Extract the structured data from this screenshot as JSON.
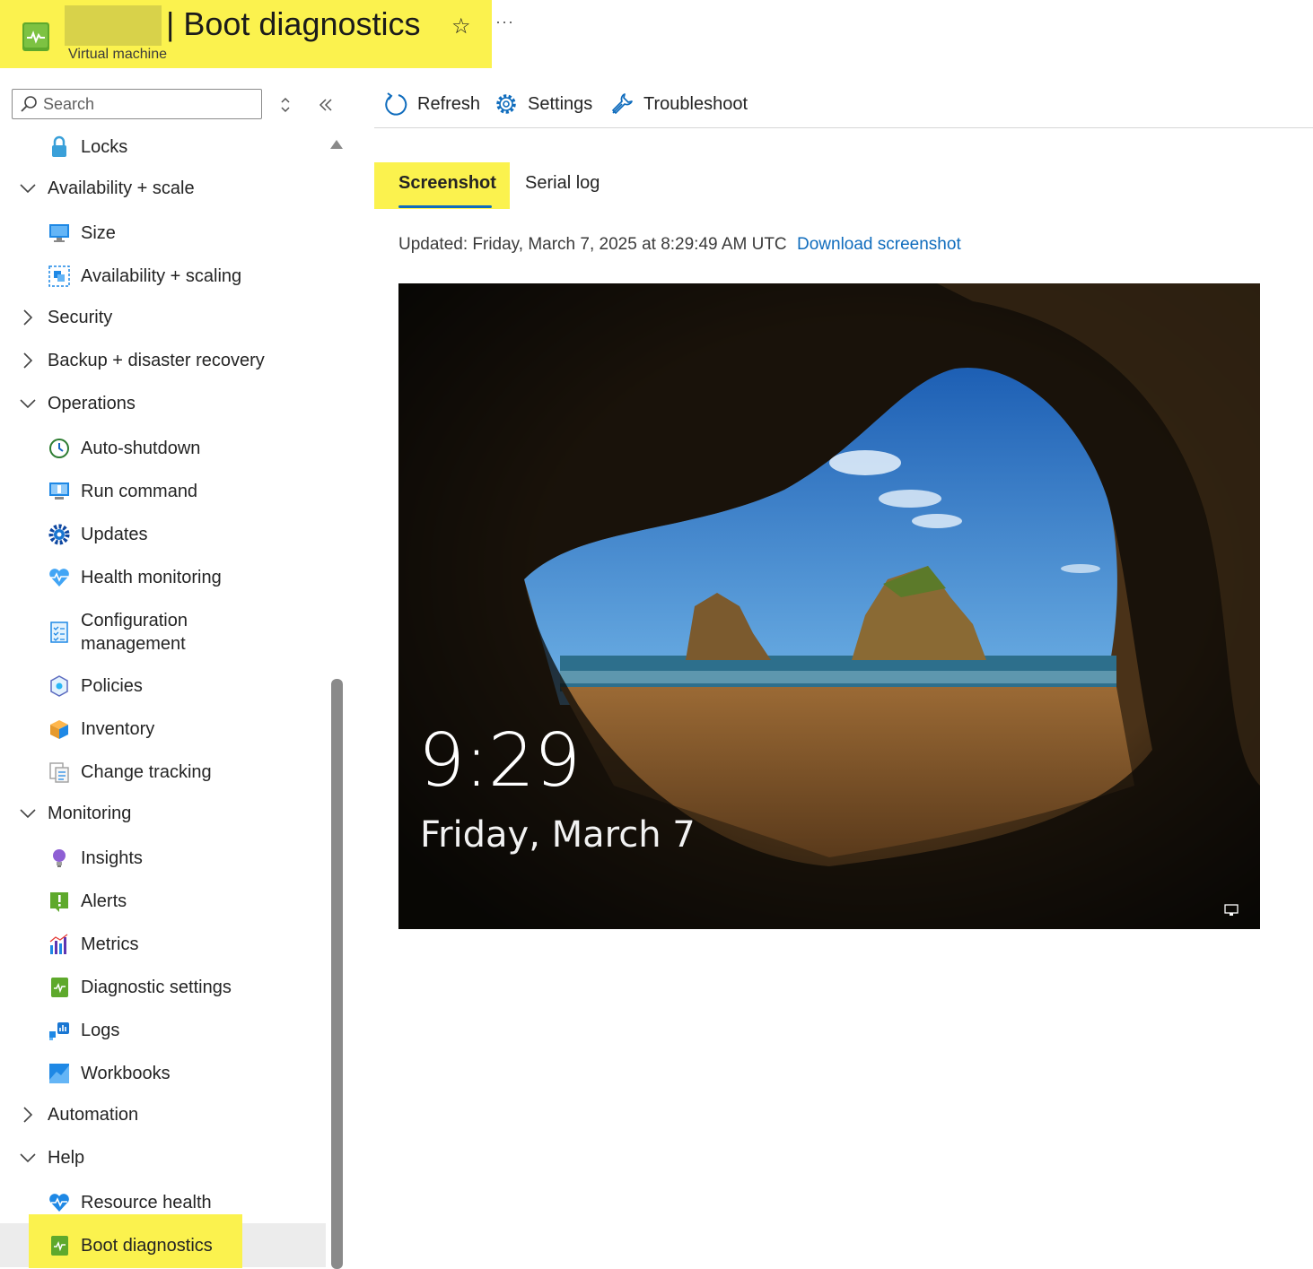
{
  "header": {
    "title": "| Boot diagnostics",
    "subtitle": "Virtual machine",
    "favorite_icon": "star-icon",
    "more_label": "···"
  },
  "search": {
    "placeholder": "Search"
  },
  "sidebar": {
    "items": [
      {
        "label": "Locks",
        "icon": "lock-icon"
      },
      {
        "label": "Availability + scale",
        "icon": "chevron-down-icon"
      },
      {
        "label": "Size",
        "icon": "monitor-icon"
      },
      {
        "label": "Availability + scaling",
        "icon": "scale-icon"
      },
      {
        "label": "Security",
        "icon": "chevron-right-icon"
      },
      {
        "label": "Backup + disaster recovery",
        "icon": "chevron-right-icon"
      },
      {
        "label": "Operations",
        "icon": "chevron-down-icon"
      },
      {
        "label": "Auto-shutdown",
        "icon": "clock-icon"
      },
      {
        "label": "Run command",
        "icon": "run-command-icon"
      },
      {
        "label": "Updates",
        "icon": "gear-icon"
      },
      {
        "label": "Health monitoring",
        "icon": "heart-pulse-icon"
      },
      {
        "label": "Configuration management",
        "icon": "checklist-icon"
      },
      {
        "label": "Policies",
        "icon": "policy-icon"
      },
      {
        "label": "Inventory",
        "icon": "box-icon"
      },
      {
        "label": "Change tracking",
        "icon": "document-icon"
      },
      {
        "label": "Monitoring",
        "icon": "chevron-down-icon"
      },
      {
        "label": "Insights",
        "icon": "bulb-icon"
      },
      {
        "label": "Alerts",
        "icon": "alert-icon"
      },
      {
        "label": "Metrics",
        "icon": "bar-chart-icon"
      },
      {
        "label": "Diagnostic settings",
        "icon": "diagnostic-icon"
      },
      {
        "label": "Logs",
        "icon": "logs-icon"
      },
      {
        "label": "Workbooks",
        "icon": "workbook-icon"
      },
      {
        "label": "Automation",
        "icon": "chevron-right-icon"
      },
      {
        "label": "Help",
        "icon": "chevron-down-icon"
      },
      {
        "label": "Resource health",
        "icon": "heart-icon"
      },
      {
        "label": "Boot diagnostics",
        "icon": "diagnostic-icon",
        "selected": true
      }
    ]
  },
  "toolbar": {
    "refresh": "Refresh",
    "settings": "Settings",
    "troubleshoot": "Troubleshoot"
  },
  "tabs": [
    {
      "label": "Screenshot",
      "active": true
    },
    {
      "label": "Serial log",
      "active": false
    }
  ],
  "status": {
    "updated": "Updated: Friday, March 7, 2025 at 8:29:49 AM UTC",
    "download_link": "Download screenshot"
  },
  "lockscreen": {
    "time": "9:29",
    "date": "Friday, March 7"
  },
  "colors": {
    "accent": "#0f6cbd",
    "highlight": "#fbf24e",
    "selected_row": "#ececec",
    "resource_icon": "#5ea92c"
  }
}
